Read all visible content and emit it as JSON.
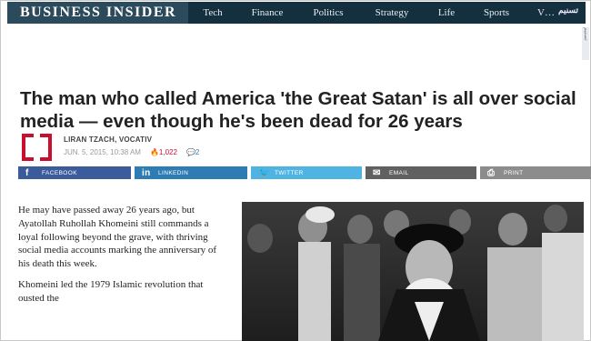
{
  "nav": {
    "brand": "BUSINESS INSIDER",
    "links": [
      "Tech",
      "Finance",
      "Politics",
      "Strategy",
      "Life",
      "Sports",
      "V…"
    ],
    "watermark": "تسنیم"
  },
  "side_tag": "تسنیم",
  "article": {
    "headline": "The man who called America 'the Great Satan' is all over social media — even though he's been dead for 26 years",
    "author": "LIRAN TZACH, VOCATIV",
    "date": "JUN. 5, 2015, 10:38 AM",
    "views": "1,022",
    "comments": "2",
    "paragraphs": [
      "He may have passed away 26 years ago, but Ayatollah Ruhollah Khomeini still commands a loyal following beyond the grave, with thriving social media accounts marking the anniversary of his death this week.",
      "Khomeini led the 1979 Islamic revolution that ousted the"
    ]
  },
  "share": {
    "facebook": "FACEBOOK",
    "linkedin": "LINKEDIN",
    "twitter": "TWITTER",
    "email": "EMAIL",
    "print": "PRINT"
  }
}
